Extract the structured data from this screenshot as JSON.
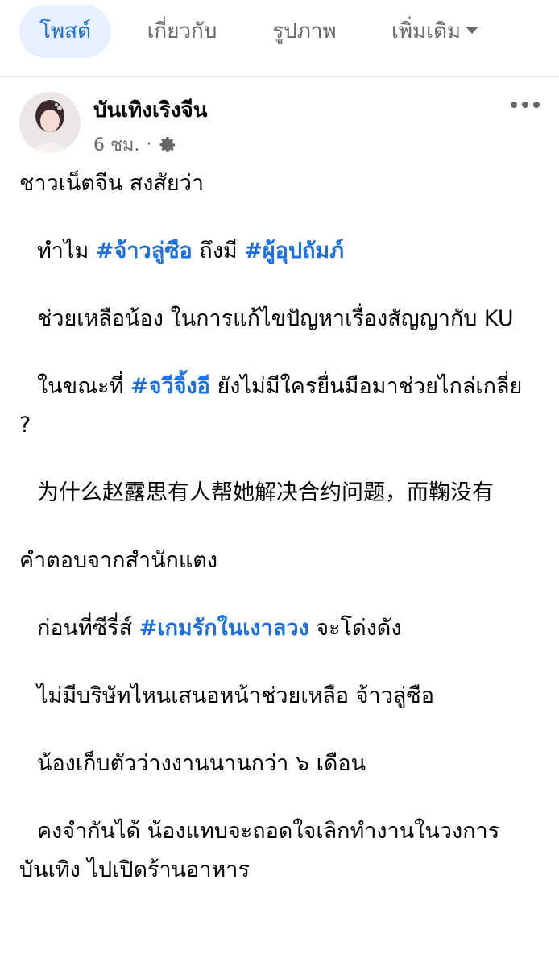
{
  "tabs": [
    {
      "label": "โพสต์",
      "active": true
    },
    {
      "label": "เกี่ยวกับ",
      "active": false
    },
    {
      "label": "รูปภาพ",
      "active": false
    },
    {
      "label": "เพิ่มเติม",
      "active": false
    }
  ],
  "post": {
    "page_name": "บันเทิงเริงจีน",
    "time": "6 ชม.",
    "separator": "·",
    "audience_icon": "gear-icon",
    "more_icon": "more-horizontal-icon",
    "lines": {
      "l1": "ชาวเน็ตจีน สงสัยว่า",
      "l2_a": "ทำไม ",
      "l2_tag1": "#จ้าวลู่ซือ",
      "l2_b": " ถึงมี ",
      "l2_tag2": "#ผู้อุปถัมภ์",
      "l3": "ช่วยเหลือน้อง ในการแก้ไขปัญหาเรื่องสัญญากับ KU",
      "l4_a": "ในขณะที่ ",
      "l4_tag": "#จวีจิ้งอี",
      "l4_b": " ยังไม่มีใครยื่นมือมาช่วยไกล่เกลี่ย ?",
      "l5": "为什么赵露思有人帮她解决合约问题，而鞠没有",
      "l6": "คำตอบจากสำนักแตง",
      "l7_a": "ก่อนที่ซีรี่ส์ ",
      "l7_tag": "#เกมรักในเงาลวง",
      "l7_b": " จะโด่งดัง",
      "l8": "ไม่มีบริษัทไหนเสนอหน้าช่วยเหลือ จ้าวลู่ซือ",
      "l9": "น้องเก็บตัวว่างงานนานกว่า ๖ เดือน",
      "l10": "คงจำกันได้ น้องแทบจะถอดใจเลิกทำงานในวงการบันเทิง ไปเปิดร้านอาหาร"
    }
  },
  "colors": {
    "accent": "#1b6fde",
    "tab_active_bg": "#e7f0fd",
    "muted": "#65676b",
    "divider": "#dddfe2"
  }
}
